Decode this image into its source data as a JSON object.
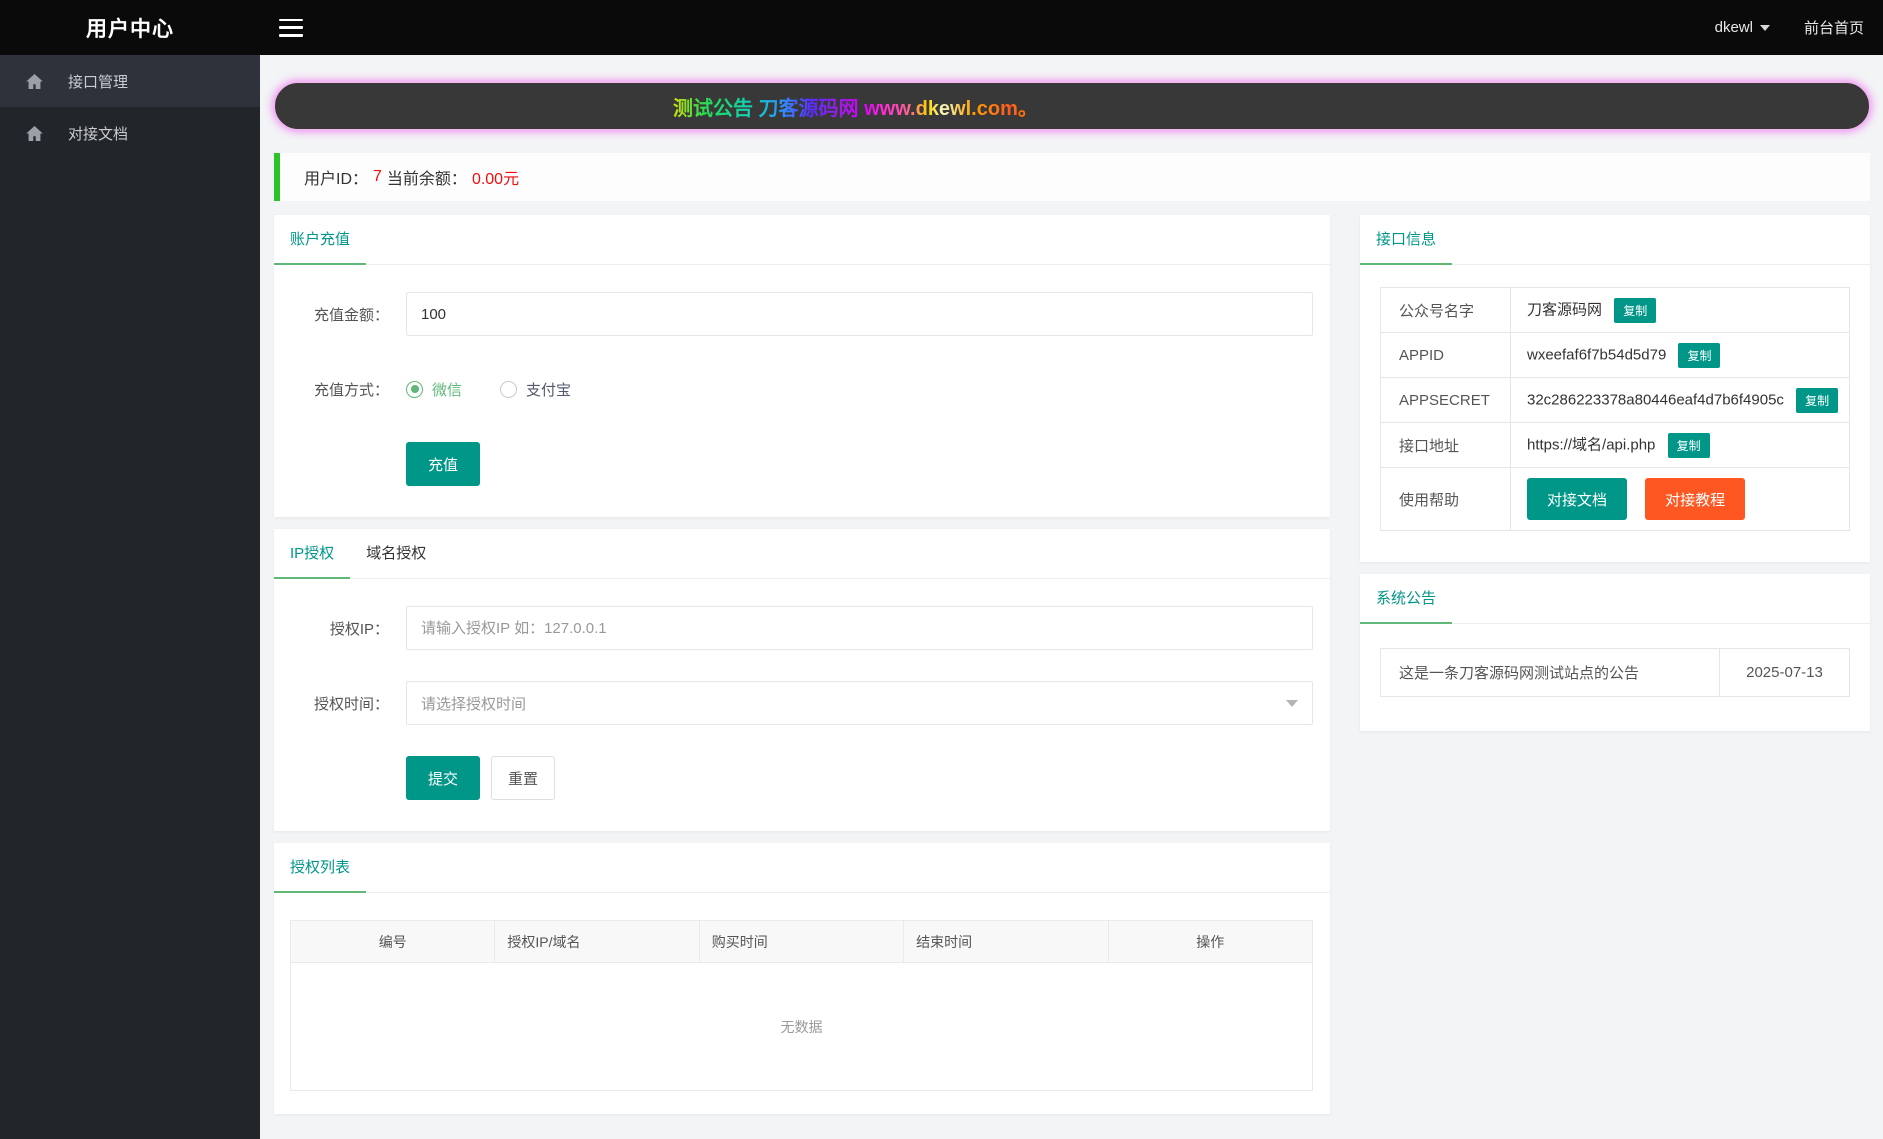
{
  "header": {
    "title": "用户中心",
    "username": "dkewl",
    "front_link": "前台首页"
  },
  "sidebar": {
    "items": [
      {
        "label": "接口管理"
      },
      {
        "label": "对接文档"
      }
    ]
  },
  "banner": {
    "text": "测试公告 刀客源码网 www.dkewl.com。"
  },
  "user_bar": {
    "id_label": "用户ID：",
    "id_value": "7",
    "balance_label": "当前余额：",
    "balance_value": "0.00元"
  },
  "recharge": {
    "tab": "账户充值",
    "amount_label": "充值金额：",
    "amount_value": "100",
    "method_label": "充值方式：",
    "methods": [
      {
        "label": "微信",
        "checked": true
      },
      {
        "label": "支付宝",
        "checked": false
      }
    ],
    "submit_label": "充值"
  },
  "auth": {
    "tabs": [
      {
        "label": "IP授权"
      },
      {
        "label": "域名授权"
      }
    ],
    "ip_label": "授权IP：",
    "ip_placeholder": "请输入授权IP 如：127.0.0.1",
    "time_label": "授权时间：",
    "time_placeholder": "请选择授权时间",
    "submit_label": "提交",
    "reset_label": "重置"
  },
  "auth_list": {
    "tab": "授权列表",
    "columns": [
      "编号",
      "授权IP/域名",
      "购买时间",
      "结束时间",
      "操作"
    ],
    "empty_text": "无数据"
  },
  "api_info": {
    "tab": "接口信息",
    "copy_label": "复制",
    "rows": [
      {
        "label": "公众号名字",
        "value": "刀客源码网"
      },
      {
        "label": "APPID",
        "value": "wxeefaf6f7b54d5d79"
      },
      {
        "label": "APPSECRET",
        "value": "32c286223378a80446eaf4d7b6f4905c"
      },
      {
        "label": "接口地址",
        "value": "https://域名/api.php"
      }
    ],
    "help_label": "使用帮助",
    "help_doc": "对接文档",
    "help_tutorial": "对接教程"
  },
  "notice": {
    "tab": "系统公告",
    "rows": [
      {
        "text": "这是一条刀客源码网测试站点的公告",
        "date": "2025-07-13"
      }
    ]
  },
  "colors": {
    "accent_teal": "#009688",
    "accent_green": "#5FB878",
    "accent_orange": "#FF5722",
    "danger_red": "#f20d0d",
    "info_bar_green": "#2bc327"
  }
}
